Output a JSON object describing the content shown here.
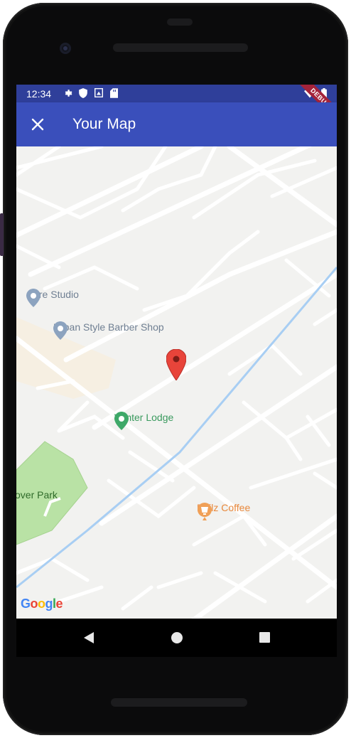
{
  "status_bar": {
    "time": "12:34",
    "left_icons": [
      "gear-icon",
      "shield-icon",
      "sim-icon",
      "sd-card-icon"
    ],
    "right_icons": [
      "wifi-icon",
      "battery-icon"
    ],
    "debug_banner": "DEBUG"
  },
  "app_bar": {
    "close_icon": "close-icon",
    "title": "Your Map",
    "color": "#3a4fbb"
  },
  "map": {
    "pois": [
      {
        "label": "Core Studio",
        "icon": "place-pin-icon",
        "color": "#6f8aa6"
      },
      {
        "label": "Urban Style Barber Shop",
        "icon": "place-pin-icon",
        "color": "#6f8aa6"
      },
      {
        "label": "Winter Lodge",
        "icon": "green-place-pin-icon",
        "color": "#2e9e5b"
      },
      {
        "label": "Philz Coffee",
        "icon": "coffee-cup-icon",
        "color": "#ec8a3c"
      }
    ],
    "park_label": "over Park",
    "marker": {
      "icon": "red-map-marker-icon",
      "color": "#e8443a"
    },
    "attribution": "Google"
  },
  "nav_bar": {
    "back": "back-triangle-icon",
    "home": "home-circle-icon",
    "recents": "recents-square-icon"
  }
}
